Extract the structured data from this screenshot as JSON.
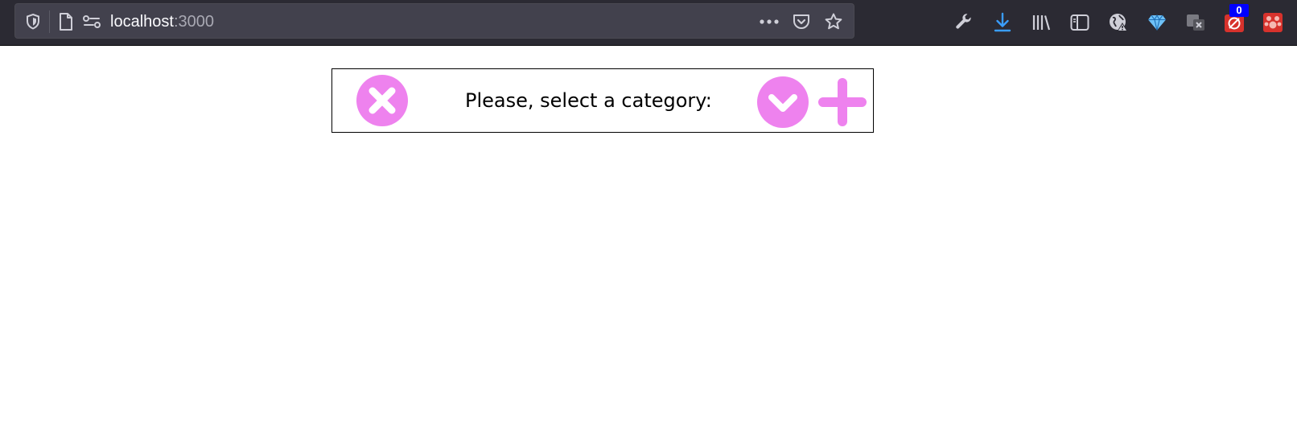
{
  "browser": {
    "url_host": "localhost",
    "url_port": ":3000",
    "extension_badge_count": "0",
    "icons": {
      "tracking_protection": "shield-icon",
      "page": "page-icon",
      "permissions": "permissions-icon",
      "page_actions": "more-dots-icon",
      "pocket": "pocket-icon",
      "bookmark": "star-icon",
      "devtools": "wrench-icon",
      "downloads": "download-icon",
      "library": "library-icon",
      "sidebar": "sidebar-icon",
      "extensions": [
        "globe-warning-icon",
        "diamond-icon",
        "translate-icon",
        "extension-badge-icon",
        "extension-paw-icon"
      ]
    },
    "colors": {
      "toolbar_bg": "#2b2a33",
      "urlbar_bg": "#42414d",
      "download_accent": "#3a9dfb",
      "badge_bg": "#0000ff",
      "extension_red": "#d7322c"
    }
  },
  "app": {
    "prompt": "Please, select a category:",
    "buttons": {
      "clear": "close-circle-icon",
      "expand": "chevron-down-circle-icon",
      "add": "plus-icon"
    },
    "accent_color": "#ee82ee"
  }
}
